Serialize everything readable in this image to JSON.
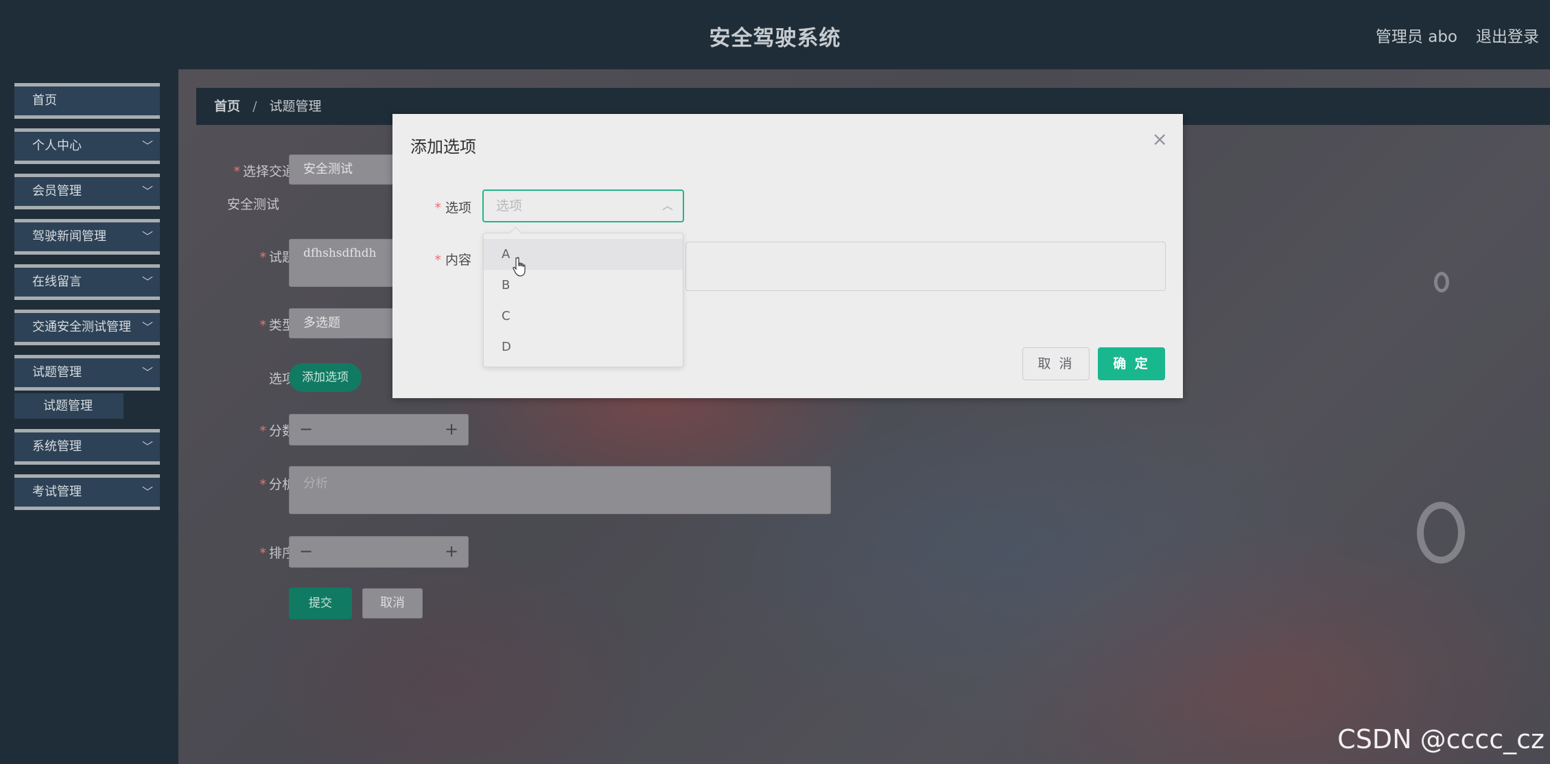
{
  "header": {
    "title": "安全驾驶系统",
    "admin_label": "管理员 abo",
    "logout": "退出登录"
  },
  "sidebar": {
    "items": [
      {
        "label": "首页",
        "has_children": false
      },
      {
        "label": "个人中心",
        "has_children": true
      },
      {
        "label": "会员管理",
        "has_children": true
      },
      {
        "label": "驾驶新闻管理",
        "has_children": true
      },
      {
        "label": "在线留言",
        "has_children": true
      },
      {
        "label": "交通安全测试管理",
        "has_children": true
      },
      {
        "label": "试题管理",
        "has_children": true
      },
      {
        "label": "系统管理",
        "has_children": true
      },
      {
        "label": "考试管理",
        "has_children": true
      }
    ],
    "submenu": {
      "label": "试题管理"
    }
  },
  "breadcrumb": {
    "home": "首页",
    "separator": "/",
    "current": "试题管理"
  },
  "form": {
    "exam_label": "选择交通",
    "exam_value": "安全测试",
    "exam_label_cont": "安全测试",
    "question_label": "试题",
    "question_value": "dfhshsdfhdh",
    "type_label": "类型",
    "type_value": "多选题",
    "options_label": "选项",
    "add_option_button": "添加选项",
    "score_label": "分数",
    "analysis_label": "分析",
    "analysis_placeholder": "分析",
    "sort_label": "排序",
    "submit_button": "提交",
    "cancel_button": "取消",
    "minus": "−",
    "plus": "+"
  },
  "dialog": {
    "title": "添加选项",
    "close": "×",
    "option_label": "选项",
    "option_placeholder": "选项",
    "content_label": "内容",
    "cancel_button": "取 消",
    "confirm_button": "确 定",
    "dropdown_options": [
      "A",
      "B",
      "C",
      "D"
    ],
    "hovered_option": "A"
  },
  "watermark": "CSDN @cccc_cz",
  "colors": {
    "accent": "#19b78d",
    "sidebar_bg": "#1f2d38",
    "menu_bg": "#2d4256",
    "required": "#f56c6c"
  }
}
